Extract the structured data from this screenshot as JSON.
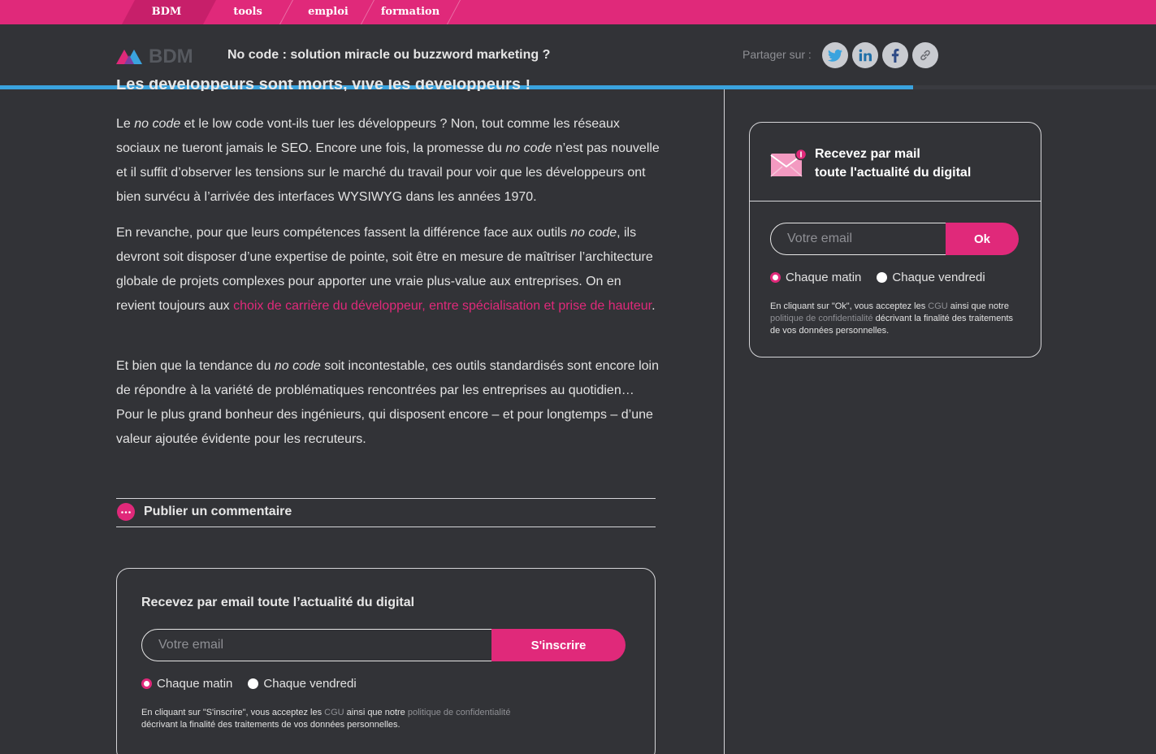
{
  "topnav": {
    "tabs": [
      {
        "label": "BDM",
        "active": true
      },
      {
        "label": "tools",
        "active": false
      },
      {
        "label": "emploi",
        "active": false
      },
      {
        "label": "formation",
        "active": false
      }
    ]
  },
  "header": {
    "logo_text": "BDM",
    "title": "No code : solution miracle ou buzzword marketing ?",
    "share_label": "Partager sur :",
    "share_icons": [
      "twitter-icon",
      "linkedin-icon",
      "facebook-icon",
      "link-icon"
    ],
    "reading_progress": 0.79
  },
  "article": {
    "cut_heading": "Les développeurs sont morts, vive les développeurs !",
    "paragraphs": [
      [
        "Le ",
        "no code",
        " et le low code vont-ils tuer les développeurs ? Non, tout comme les réseaux sociaux ne tueront jamais le SEO. Encore une fois, la promesse du ",
        "no code",
        " n’est pas nouvelle et il suffit d’observer les tensions sur le marché du travail pour voir que les développeurs ont bien survécu à l’arrivée des interfaces WYSIWYG dans les années 1970."
      ],
      [
        "En revanche, pour que leurs compétences fassent la différence face aux outils ",
        "no code",
        ", ils devront soit disposer d’une expertise de pointe, soit être en mesure de maîtriser l’architecture globale de projets complexes pour apporter une vraie plus-value aux entreprises. On en revient toujours aux ",
        "choix de carrière du développeur, entre spécialisation et prise de hauteur",
        "."
      ],
      [
        "Et bien que la tendance du ",
        "no code",
        " soit incontestable, ces outils standardisés sont encore loin de répondre à la variété de problématiques rencontrées par les entreprises au quotidien… Pour le plus grand bonheur des ingénieurs, qui disposent encore – et pour longtemps – d’une valeur ajoutée évidente pour les recruteurs."
      ]
    ],
    "comment_label": "Publier un commentaire"
  },
  "newsletter_bottom": {
    "title": "Recevez par email toute l’actualité du digital",
    "placeholder": "Votre email",
    "button": "S'inscrire",
    "options": [
      {
        "label": "Chaque matin",
        "checked": true
      },
      {
        "label": "Chaque vendredi",
        "checked": false
      }
    ],
    "legal": {
      "part1": "En cliquant sur \"S'inscrire\", vous acceptez les ",
      "cgu": "CGU",
      "part2": " ainsi que notre ",
      "privacy": "politique de confidentialité",
      "part3": " décrivant la finalité des traitements de vos données personnelles."
    }
  },
  "newsletter_side": {
    "title_line1": "Recevez par mail",
    "title_line2": "toute l'actualité du digital",
    "placeholder": "Votre email",
    "button": "Ok",
    "options": [
      {
        "label": "Chaque matin",
        "checked": true
      },
      {
        "label": "Chaque vendredi",
        "checked": false
      }
    ],
    "legal": {
      "part1": "En cliquant sur \"Ok\", vous acceptez les ",
      "cgu": "CGU",
      "part2": " ainsi que notre ",
      "privacy": "politique de confidentialité",
      "part3": " décrivant la finalité des traitements de vos données personnelles."
    }
  },
  "colors": {
    "accent": "#e0297a",
    "progress": "#3aa3de",
    "background": "#323337"
  }
}
